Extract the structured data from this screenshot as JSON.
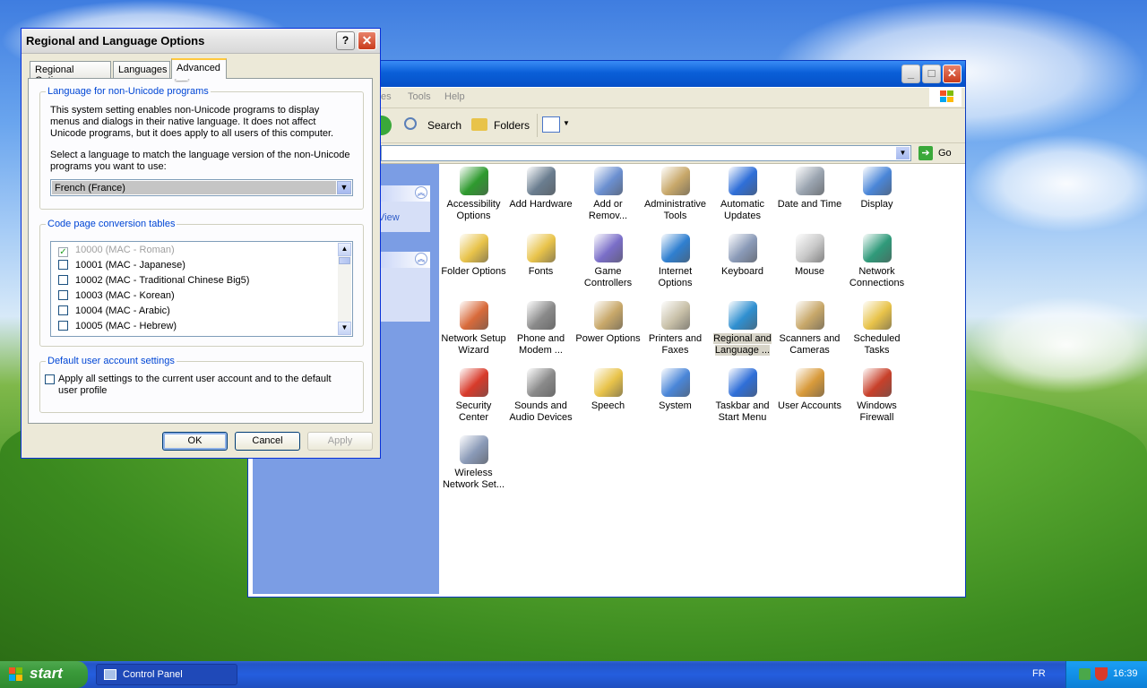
{
  "dialog": {
    "title": "Regional and Language Options",
    "help_label": "?",
    "close_label": "✕",
    "tabs": [
      {
        "label": "Regional Options",
        "active": false
      },
      {
        "label": "Languages",
        "active": false
      },
      {
        "label": "Advanced",
        "active": true
      }
    ],
    "non_unicode": {
      "group_title": "Language for non-Unicode programs",
      "description": "This system setting enables non-Unicode programs to display menus and dialogs in their native language. It does not affect Unicode programs, but it does apply to all users of this computer.",
      "instruction": "Select a language to match the language version of the non-Unicode programs you want to use:",
      "selected_language": "French (France)"
    },
    "code_page": {
      "group_title": "Code page conversion tables",
      "items": [
        {
          "label": "10000 (MAC - Roman)",
          "checked": true,
          "disabled": true
        },
        {
          "label": "10001 (MAC - Japanese)",
          "checked": false,
          "disabled": false
        },
        {
          "label": "10002 (MAC - Traditional Chinese Big5)",
          "checked": false,
          "disabled": false
        },
        {
          "label": "10003 (MAC - Korean)",
          "checked": false,
          "disabled": false
        },
        {
          "label": "10004 (MAC - Arabic)",
          "checked": false,
          "disabled": false
        },
        {
          "label": "10005 (MAC - Hebrew)",
          "checked": false,
          "disabled": false
        }
      ]
    },
    "default_user": {
      "group_title": "Default user account settings",
      "checkbox_label": "Apply all settings to the current user account and to the default user profile",
      "checked": false
    },
    "buttons": {
      "ok": "OK",
      "cancel": "Cancel",
      "apply": "Apply"
    }
  },
  "control_panel": {
    "menu": [
      "es",
      "Tools",
      "Help"
    ],
    "toolbar": {
      "search": "Search",
      "folders": "Folders"
    },
    "address": {
      "go": "Go"
    },
    "sidebar": {
      "view_text": "View"
    },
    "items": [
      {
        "label": "Accessibility Options",
        "icon": "accessibility-icon",
        "color": "#2e9a2e"
      },
      {
        "label": "Add Hardware",
        "icon": "add-hardware-icon",
        "color": "#6a7d8f"
      },
      {
        "label": "Add or Remov...",
        "icon": "add-remove-programs-icon",
        "color": "#6b8fd0"
      },
      {
        "label": "Administrative Tools",
        "icon": "administrative-tools-icon",
        "color": "#c8a86a"
      },
      {
        "label": "Automatic Updates",
        "icon": "automatic-updates-icon",
        "color": "#2f6fd8"
      },
      {
        "label": "Date and Time",
        "icon": "date-time-icon",
        "color": "#9aa4b0"
      },
      {
        "label": "Display",
        "icon": "display-icon",
        "color": "#4a86d8"
      },
      {
        "label": "Folder Options",
        "icon": "folder-options-icon",
        "color": "#e8c34a"
      },
      {
        "label": "Fonts",
        "icon": "fonts-icon",
        "color": "#e8c34a"
      },
      {
        "label": "Game Controllers",
        "icon": "game-controllers-icon",
        "color": "#7a6ec8"
      },
      {
        "label": "Internet Options",
        "icon": "internet-options-icon",
        "color": "#2f7fd0"
      },
      {
        "label": "Keyboard",
        "icon": "keyboard-icon",
        "color": "#8a9ab8"
      },
      {
        "label": "Mouse",
        "icon": "mouse-icon",
        "color": "#c8c8c8"
      },
      {
        "label": "Network Connections",
        "icon": "network-connections-icon",
        "color": "#2f9a7a"
      },
      {
        "label": "Network Setup Wizard",
        "icon": "network-setup-wizard-icon",
        "color": "#d86a3a"
      },
      {
        "label": "Phone and Modem ...",
        "icon": "phone-modem-icon",
        "color": "#8a8a8a"
      },
      {
        "label": "Power Options",
        "icon": "power-options-icon",
        "color": "#c8a86a"
      },
      {
        "label": "Printers and Faxes",
        "icon": "printers-faxes-icon",
        "color": "#c8c0a8"
      },
      {
        "label": "Regional and Language ...",
        "icon": "regional-language-icon",
        "color": "#2f8fd0",
        "selected": true
      },
      {
        "label": "Scanners and Cameras",
        "icon": "scanners-cameras-icon",
        "color": "#c8a86a"
      },
      {
        "label": "Scheduled Tasks",
        "icon": "scheduled-tasks-icon",
        "color": "#e8c34a"
      },
      {
        "label": "Security Center",
        "icon": "security-center-icon",
        "color": "#d83a2a"
      },
      {
        "label": "Sounds and Audio Devices",
        "icon": "sounds-audio-icon",
        "color": "#8a8a8a"
      },
      {
        "label": "Speech",
        "icon": "speech-icon",
        "color": "#e8c34a"
      },
      {
        "label": "System",
        "icon": "system-icon",
        "color": "#4a86d8"
      },
      {
        "label": "Taskbar and Start Menu",
        "icon": "taskbar-start-menu-icon",
        "color": "#2f6fd8"
      },
      {
        "label": "User Accounts",
        "icon": "user-accounts-icon",
        "color": "#d89a3a"
      },
      {
        "label": "Windows Firewall",
        "icon": "windows-firewall-icon",
        "color": "#c8402a"
      },
      {
        "label": "Wireless Network Set...",
        "icon": "wireless-network-icon",
        "color": "#8a9ab8"
      }
    ]
  },
  "taskbar": {
    "start_label": "start",
    "task_label": "Control Panel",
    "language": "FR",
    "clock": "16:39"
  }
}
